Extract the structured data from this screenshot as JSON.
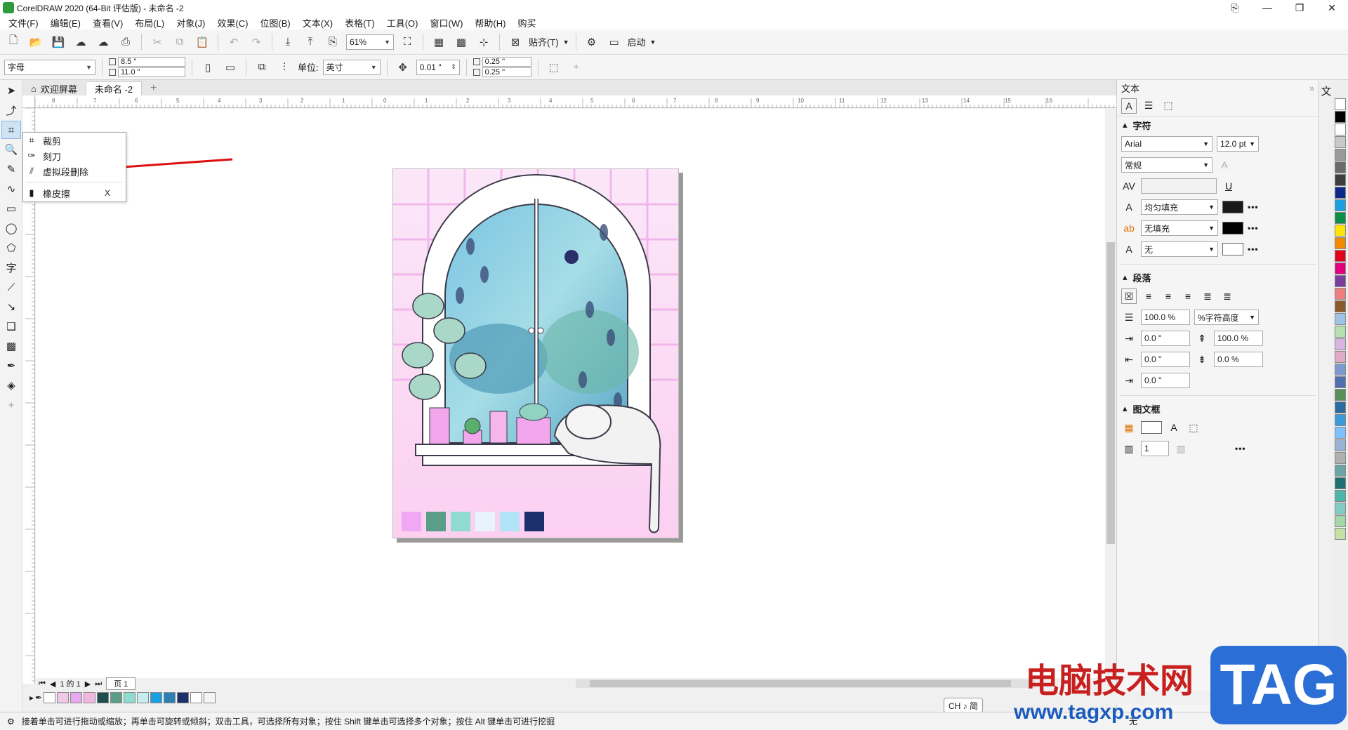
{
  "titlebar": {
    "title": "CorelDRAW 2020 (64-Bit 评估版) - 未命名 -2",
    "min": "—",
    "restore": "❐",
    "close": "✕"
  },
  "menu": [
    "文件(F)",
    "编辑(E)",
    "查看(V)",
    "布局(L)",
    "对象(J)",
    "效果(C)",
    "位图(B)",
    "文本(X)",
    "表格(T)",
    "工具(O)",
    "窗口(W)",
    "帮助(H)",
    "购买"
  ],
  "toolbar1": {
    "zoom": "61%",
    "snap_label": "贴齐(T)",
    "launch_label": "启动"
  },
  "toolbar2": {
    "font_filter": "字母",
    "width": "8.5 \"",
    "height": "11.0 \"",
    "unit_label": "单位:",
    "unit": "英寸",
    "nudge": "0.01 \"",
    "dup_x": "0.25 \"",
    "dup_y": "0.25 \""
  },
  "doctabs": {
    "home": "欢迎屏幕",
    "doc": "未命名 -2"
  },
  "ruler_ticks": [
    "8",
    "7",
    "6",
    "5",
    "4",
    "3",
    "2",
    "1",
    "0",
    "1",
    "2",
    "3",
    "4",
    "5",
    "6",
    "7",
    "8",
    "9",
    "10",
    "11",
    "12",
    "13",
    "14",
    "15",
    "16"
  ],
  "flyout": {
    "items": [
      {
        "label": "裁剪",
        "key": ""
      },
      {
        "label": "刻刀",
        "key": ""
      },
      {
        "label": "虚拟段删除",
        "key": ""
      },
      {
        "label": "橡皮擦",
        "key": "X"
      }
    ]
  },
  "dock": {
    "title": "文本",
    "char_section": "字符",
    "font": "Arial",
    "size": "12.0 pt",
    "style": "常规",
    "fill": "均匀填充",
    "bg_fill": "无填充",
    "outline": "无",
    "para_section": "段落",
    "line_spacing": "100.0 %",
    "line_unit": "%字符高度",
    "indent_first": "0.0 \"",
    "indent_left": "0.0 \"",
    "indent_right": "0.0 \"",
    "before_para": "100.0 %",
    "after_para": "0.0 %",
    "frame_section": "图文框",
    "columns": "1"
  },
  "pagebar": {
    "page": "页 1",
    "count": "1 的 1"
  },
  "statusbar": {
    "hint": "接着单击可进行拖动或缩放；再单击可旋转或倾斜；双击工具，可选择所有对象；按住 Shift 键单击可选择多个对象；按住 Alt 键单击可进行挖掘",
    "fill_none": "无"
  },
  "ime": "CH ♪ 简",
  "watermark": {
    "text": "电脑技术网",
    "url": "www.tagxp.com",
    "tag": "TAG"
  },
  "colors": {
    "swatches": [
      "#f0a8f5",
      "#5a9e88",
      "#8fdbd0",
      "#e9f3fb",
      "#b0e4f6",
      "#1e2f6e"
    ],
    "palette": [
      "#ffffff",
      "#000000",
      "#ffffff",
      "#c9c9c9",
      "#9a9a9a",
      "#6b6b6b",
      "#3e3e3e",
      "#0b2a88",
      "#1aa0e0",
      "#0a8f46",
      "#ffe600",
      "#f28a00",
      "#e2001a",
      "#e4007d",
      "#7a3d9a",
      "#f07d7d",
      "#8b5a2b",
      "#a0c4e8",
      "#b7e0b0",
      "#d8b4e0",
      "#e0a9c6",
      "#7c9acb",
      "#4f6fb0",
      "#5a8f5a",
      "#2d6b9e",
      "#3a9ad9",
      "#7fc1ff",
      "#9bb1d3",
      "#b0b0b0",
      "#6ba5a5",
      "#1e6f6f",
      "#4db6ac",
      "#80cbc4",
      "#a5d6a7",
      "#c5e1a5"
    ],
    "docpalette": [
      "#ffffff",
      "#f0c8e8",
      "#e8a8f0",
      "#f0b8e0",
      "#1e4f4f",
      "#5a9e88",
      "#8fdbd0",
      "#c6eef0",
      "#1aa0e0",
      "#2e7fb3",
      "#1e2f6e",
      "#ffffff",
      "#f5f5f5"
    ]
  }
}
